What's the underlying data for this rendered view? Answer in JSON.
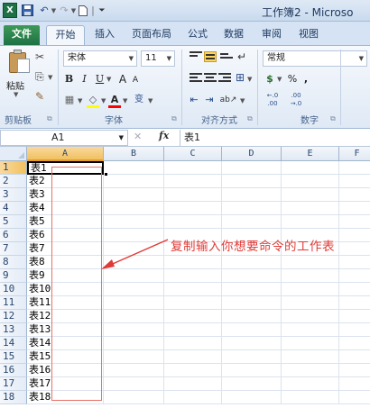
{
  "app": {
    "title": "工作簿2 - Microso",
    "logo_text": "X",
    "quick_access": [
      "save-icon",
      "undo-icon",
      "redo-icon",
      "new-file-icon",
      "customize-icon"
    ]
  },
  "tabs": [
    "文件",
    "开始",
    "插入",
    "页面布局",
    "公式",
    "数据",
    "审阅",
    "视图"
  ],
  "ribbon": {
    "clipboard": {
      "paste": "粘贴",
      "cut_glyph": "✂",
      "copy_glyph": "⎘",
      "painter_glyph": "✎",
      "group": "剪贴板"
    },
    "font": {
      "name": "宋体",
      "size": "11",
      "bold": "B",
      "italic": "I",
      "underline": "U",
      "grow": "A",
      "shrink": "A",
      "border_glyph": "▦",
      "fill_glyph": "◇",
      "color_glyph": "A",
      "phonetic_glyph": "变",
      "group": "字体",
      "fill_color": "#ffff00",
      "font_color": "#ff0000"
    },
    "alignment": {
      "indent_dec": "⇤",
      "indent_inc": "⇥",
      "orient": "ab↗",
      "wrap_glyph": "↵",
      "merge_glyph": "⊞",
      "group": "对齐方式"
    },
    "number": {
      "format": "常规",
      "currency_glyph": "$",
      "percent": "%",
      "comma": ",",
      "inc_dec": "←.0 .00",
      "dec_dec": ".00 →.0",
      "group": "数字"
    }
  },
  "formula_bar": {
    "name_box": "A1",
    "cancel_glyph": "✕",
    "fx_label": "fx",
    "content": "表1"
  },
  "grid": {
    "columns": [
      "A",
      "B",
      "C",
      "D",
      "E",
      "F"
    ],
    "selected_column": "A",
    "active_cell": "A1",
    "rows": [
      {
        "num": "1",
        "a": "表1"
      },
      {
        "num": "2",
        "a": "表2"
      },
      {
        "num": "3",
        "a": "表3"
      },
      {
        "num": "4",
        "a": "表4"
      },
      {
        "num": "5",
        "a": "表5"
      },
      {
        "num": "6",
        "a": "表6"
      },
      {
        "num": "7",
        "a": "表7"
      },
      {
        "num": "8",
        "a": "表8"
      },
      {
        "num": "9",
        "a": "表9"
      },
      {
        "num": "10",
        "a": "表10"
      },
      {
        "num": "11",
        "a": "表11"
      },
      {
        "num": "12",
        "a": "表12"
      },
      {
        "num": "13",
        "a": "表13"
      },
      {
        "num": "14",
        "a": "表14"
      },
      {
        "num": "15",
        "a": "表15"
      },
      {
        "num": "16",
        "a": "表16"
      },
      {
        "num": "17",
        "a": "表17"
      },
      {
        "num": "18",
        "a": "表18"
      }
    ]
  },
  "annotation": {
    "text": "复制输入你想要命令的工作表",
    "color": "#e03a36"
  },
  "colors": {
    "accent": "#1e7145",
    "selection_header": "#f1c15f"
  }
}
